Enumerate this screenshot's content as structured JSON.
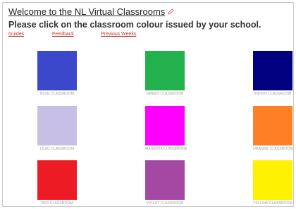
{
  "header": {
    "title": "Welcome to the NL Virtual Classrooms",
    "instruction": "Please click on the classroom colour issued by your school."
  },
  "links": [
    {
      "label": "Guides"
    },
    {
      "label": "Feedback"
    },
    {
      "label": "Previous Weeks"
    }
  ],
  "colors": {
    "link": "#c0392b",
    "edit_icon": "#e05a6a"
  },
  "classrooms": [
    {
      "label": "BLUE CLASSROOM",
      "color": "#3b48cc"
    },
    {
      "label": "GREEN CLASSROOM",
      "color": "#22b14c"
    },
    {
      "label": "INDIGO CLASSROOM",
      "color": "#000080"
    },
    {
      "label": "LILAC CLASSROOM",
      "color": "#c8bfe7"
    },
    {
      "label": "MAGENTA CLASSROOM",
      "color": "#ff00ff"
    },
    {
      "label": "ORANGE CLASSROOM",
      "color": "#ff7f27"
    },
    {
      "label": "RED CLASSROOM",
      "color": "#ed1c24"
    },
    {
      "label": "VIOLET CLASSROOM",
      "color": "#a349a4"
    },
    {
      "label": "YELLOW CLASSROOM",
      "color": "#fff200"
    }
  ]
}
